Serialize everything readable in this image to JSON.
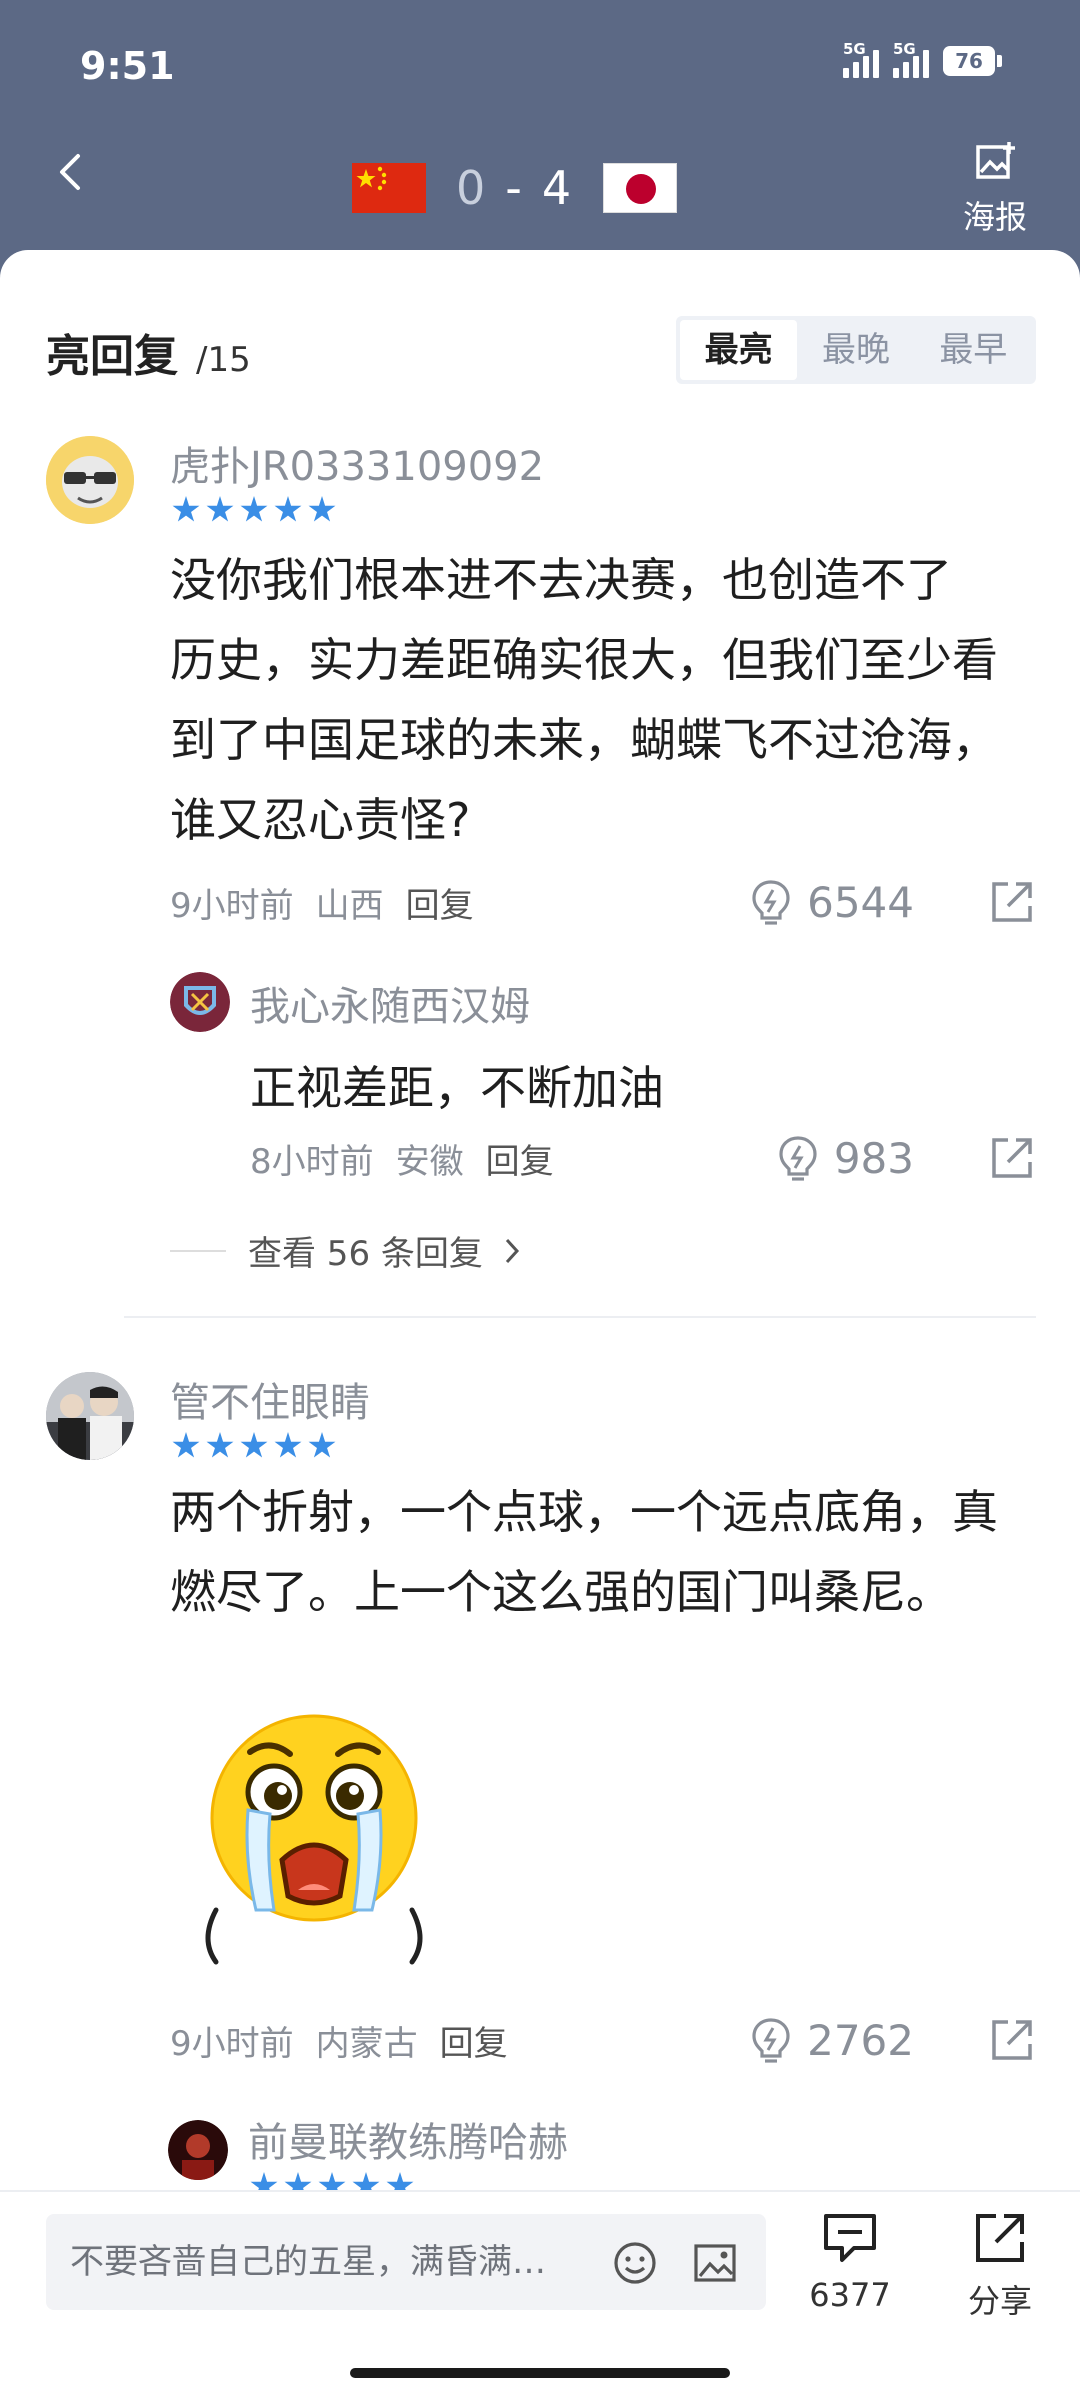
{
  "status_bar": {
    "time": "9:51",
    "network1": "5G",
    "network2": "5G",
    "battery": "76"
  },
  "match": {
    "home_score": "0",
    "separator": "-",
    "away_score": "4",
    "home_flag": "flag-china-icon",
    "away_flag": "flag-japan-icon"
  },
  "header": {
    "poster_label": "海报"
  },
  "section": {
    "title": "亮回复",
    "count": "/15"
  },
  "sort_tabs": [
    {
      "label": "最亮",
      "active": true
    },
    {
      "label": "最晚",
      "active": false
    },
    {
      "label": "最早",
      "active": false
    }
  ],
  "comments": [
    {
      "user": "虎扑JR0333109092",
      "stars": 5,
      "text_lines": [
        "没你我们根本进不去决赛，也创造不了",
        "历史，实力差距确实很大，但我们至少看",
        "到了中国足球的未来，蝴蝶飞不过沧海，",
        "谁又忍心责怪?"
      ],
      "time": "9小时前",
      "location": "山西",
      "reply_label": "回复",
      "likes": "6544",
      "sub_reply": {
        "user": "我心永随西汉姆",
        "text": "正视差距，不断加油",
        "time": "8小时前",
        "location": "安徽",
        "reply_label": "回复",
        "likes": "983"
      },
      "view_more": "查看 56 条回复"
    },
    {
      "user": "管不住眼睛",
      "stars": 5,
      "text_lines": [
        "两个折射，一个点球，一个远点底角，真",
        "燃尽了。上一个这么强的国门叫桑尼。"
      ],
      "time": "9小时前",
      "location": "内蒙古",
      "reply_label": "回复",
      "likes": "2762"
    },
    {
      "user": "前曼联教练腾哈赫",
      "stars": 5
    }
  ],
  "bottom_bar": {
    "input_placeholder": "不要吝啬自己的五星，满昏满…",
    "comment_count": "6377",
    "share_label": "分享"
  },
  "colors": {
    "header_bg": "#5c6985",
    "star": "#3a8ee6",
    "china_red": "#de2910",
    "japan_red": "#bc002d"
  }
}
